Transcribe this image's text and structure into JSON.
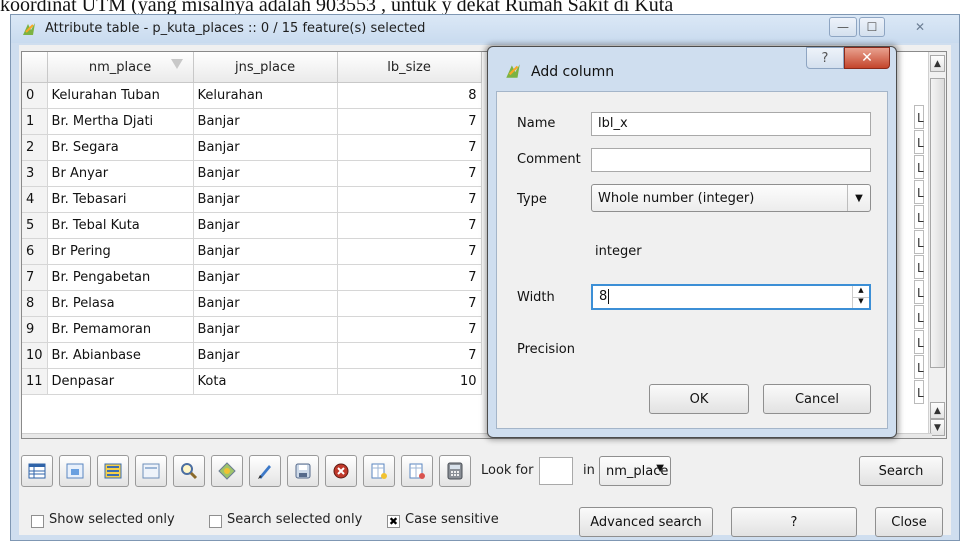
{
  "background_text": "koordinat UTM (yang misalnya adalah 903553 , untuk y dekat Rumah Sakit di Kuta",
  "window": {
    "title": "Attribute table - p_kuta_places :: 0 / 15 feature(s) selected",
    "buttons": {
      "minimize": "—",
      "maximize": "☐",
      "close": "✕"
    }
  },
  "table": {
    "columns": [
      "nm_place",
      "jns_place",
      "lb_size"
    ],
    "rows": [
      {
        "id": "0",
        "nm_place": "Kelurahan Tuban",
        "jns_place": "Kelurahan",
        "lb_size": "8"
      },
      {
        "id": "1",
        "nm_place": "Br. Mertha Djati",
        "jns_place": "Banjar",
        "lb_size": "7"
      },
      {
        "id": "2",
        "nm_place": "Br. Segara",
        "jns_place": "Banjar",
        "lb_size": "7"
      },
      {
        "id": "3",
        "nm_place": "Br Anyar",
        "jns_place": "Banjar",
        "lb_size": "7"
      },
      {
        "id": "4",
        "nm_place": "Br. Tebasari",
        "jns_place": "Banjar",
        "lb_size": "7"
      },
      {
        "id": "5",
        "nm_place": "Br. Tebal Kuta",
        "jns_place": "Banjar",
        "lb_size": "7"
      },
      {
        "id": "6",
        "nm_place": "Br Pering",
        "jns_place": "Banjar",
        "lb_size": "7"
      },
      {
        "id": "7",
        "nm_place": "Br. Pengabetan",
        "jns_place": "Banjar",
        "lb_size": "7"
      },
      {
        "id": "8",
        "nm_place": "Br. Pelasa",
        "jns_place": "Banjar",
        "lb_size": "7"
      },
      {
        "id": "9",
        "nm_place": "Br. Pemamoran",
        "jns_place": "Banjar",
        "lb_size": "7"
      },
      {
        "id": "10",
        "nm_place": "Br. Abianbase",
        "jns_place": "Banjar",
        "lb_size": "7"
      },
      {
        "id": "11",
        "nm_place": "Denpasar",
        "jns_place": "Kota",
        "lb_size": "10"
      }
    ],
    "hidden_column_stub": "L"
  },
  "toolbar": {
    "icons": [
      "table-icon",
      "invert-selection-icon",
      "select-all-icon",
      "deselect-icon",
      "zoom-to-selection-icon",
      "move-selection-to-top-icon",
      "toggle-editing-icon",
      "save-edits-icon",
      "delete-selected-icon",
      "new-column-icon",
      "delete-column-icon",
      "field-calculator-icon"
    ],
    "look_for_label": "Look for",
    "in_label": "in",
    "field_select_value": "nm_place",
    "search_label": "Search"
  },
  "bottom": {
    "show_selected_only": "Show selected only",
    "search_selected_only": "Search selected only",
    "case_sensitive": "Case sensitive",
    "advanced_search": "Advanced search",
    "help": "?",
    "close": "Close"
  },
  "dialog": {
    "title": "Add column",
    "help_button": "?",
    "close_button": "✕",
    "name_label": "Name",
    "name_value": "lbl_x",
    "comment_label": "Comment",
    "comment_value": "",
    "type_label": "Type",
    "type_value": "Whole number (integer)",
    "type_name": "integer",
    "width_label": "Width",
    "width_value": "8",
    "precision_label": "Precision",
    "ok_label": "OK",
    "cancel_label": "Cancel"
  }
}
